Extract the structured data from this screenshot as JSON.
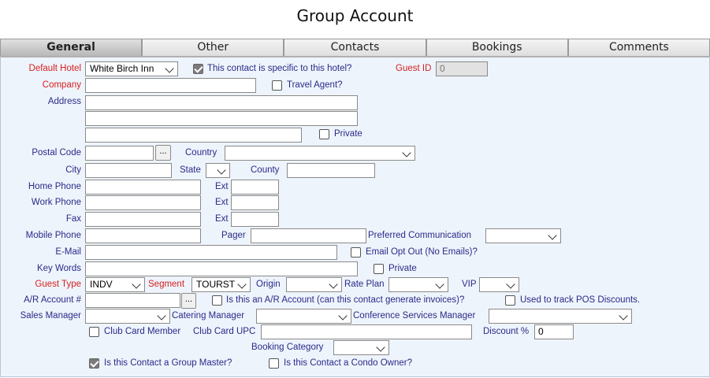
{
  "title": "Group Account",
  "tabs": [
    {
      "label": "General"
    },
    {
      "label": "Other"
    },
    {
      "label": "Contacts"
    },
    {
      "label": "Bookings"
    },
    {
      "label": "Comments"
    }
  ],
  "fields": {
    "default_hotel": {
      "label": "Default Hotel",
      "value": "White Birch Inn"
    },
    "specific_hotel": {
      "label": "This contact is specific to this hotel?",
      "checked": true
    },
    "guest_id": {
      "label": "Guest ID",
      "value": "0"
    },
    "company": {
      "label": "Company",
      "value": ""
    },
    "travel_agent": {
      "label": "Travel Agent?",
      "checked": false
    },
    "address": {
      "label": "Address"
    },
    "address_private": {
      "label": "Private",
      "checked": false
    },
    "postal_code": {
      "label": "Postal Code",
      "lookup": "..."
    },
    "country": {
      "label": "Country",
      "value": ""
    },
    "city": {
      "label": "City"
    },
    "state": {
      "label": "State",
      "value": ""
    },
    "county": {
      "label": "County"
    },
    "home_phone": {
      "label": "Home Phone",
      "ext_label": "Ext"
    },
    "work_phone": {
      "label": "Work Phone",
      "ext_label": "Ext"
    },
    "fax": {
      "label": "Fax",
      "ext_label": "Ext"
    },
    "mobile_phone": {
      "label": "Mobile Phone"
    },
    "pager": {
      "label": "Pager"
    },
    "preferred_communication": {
      "label": "Preferred Communication",
      "value": ""
    },
    "email": {
      "label": "E-Mail"
    },
    "email_opt_out": {
      "label": "Email Opt Out (No Emails)?",
      "checked": false
    },
    "key_words": {
      "label": "Key Words"
    },
    "key_words_private": {
      "label": "Private",
      "checked": false
    },
    "guest_type": {
      "label": "Guest Type",
      "value": "INDV"
    },
    "segment": {
      "label": "Segment",
      "value": "TOURST"
    },
    "origin": {
      "label": "Origin",
      "value": ""
    },
    "rate_plan": {
      "label": "Rate Plan",
      "value": ""
    },
    "vip": {
      "label": "VIP",
      "value": ""
    },
    "ar_account": {
      "label": "A/R Account #",
      "lookup": "..."
    },
    "is_ar_account": {
      "label": "Is this an A/R Account (can this contact generate invoices)?",
      "checked": false
    },
    "pos_discounts": {
      "label": "Used to track POS Discounts.",
      "checked": false
    },
    "sales_manager": {
      "label": "Sales Manager",
      "value": ""
    },
    "catering_manager": {
      "label": "Catering Manager",
      "value": ""
    },
    "conference_manager": {
      "label": "Conference Services Manager",
      "value": ""
    },
    "club_card_member": {
      "label": "Club Card Member",
      "checked": false
    },
    "club_card_upc": {
      "label": "Club Card UPC"
    },
    "discount": {
      "label": "Discount %",
      "value": "0"
    },
    "booking_category": {
      "label": "Booking Category",
      "value": ""
    },
    "group_master": {
      "label": "Is this Contact a Group Master?",
      "checked": true
    },
    "condo_owner": {
      "label": "Is this Contact a Condo Owner?",
      "checked": false
    }
  }
}
